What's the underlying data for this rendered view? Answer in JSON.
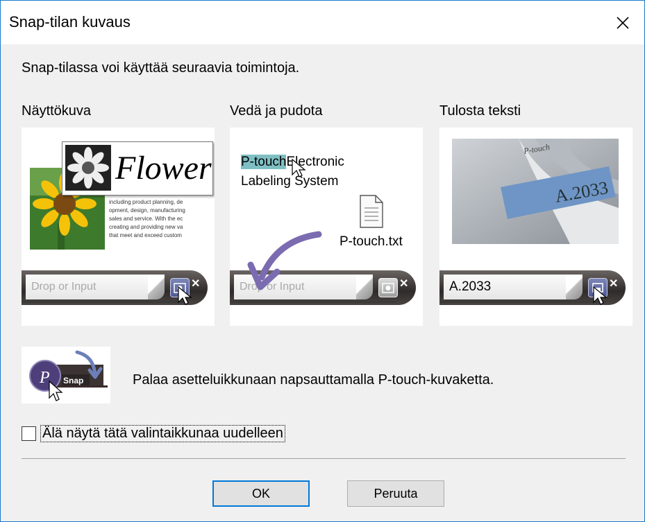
{
  "window": {
    "title": "Snap-tilan kuvaus"
  },
  "intro": "Snap-tilassa voi käyttää seuraavia toimintoja.",
  "panels": [
    {
      "label": "Näyttökuva",
      "heading": "Flower",
      "body_text": [
        "including product planning, de",
        "opment, design, manufacturing",
        "sales and service. With the ec",
        "creating and providing new va",
        "that meet and exceed custom"
      ],
      "field_text": "Drop or Input"
    },
    {
      "label": "Vedä ja pudota",
      "line1_highlight": "P-touch",
      "line1_rest": "Electronic",
      "line2": "Labeling System",
      "file_name": "P-touch.txt",
      "field_text": "Drop or Input"
    },
    {
      "label": "Tulosta teksti",
      "photo_label": "A.2033",
      "photo_brand": "P-touch",
      "field_text": "A.2033"
    }
  ],
  "snap_hint": {
    "badge_text": "Snap",
    "text": "Palaa asetteluikkunaan napsauttamalla P-touch-kuvaketta."
  },
  "checkbox": {
    "label": "Älä näytä tätä valintaikkunaa uudelleen",
    "checked": false
  },
  "buttons": {
    "ok": "OK",
    "cancel": "Peruuta"
  },
  "colors": {
    "accent": "#0078d7",
    "window_border": "#1979ca",
    "highlight": "#7fbfc4"
  }
}
